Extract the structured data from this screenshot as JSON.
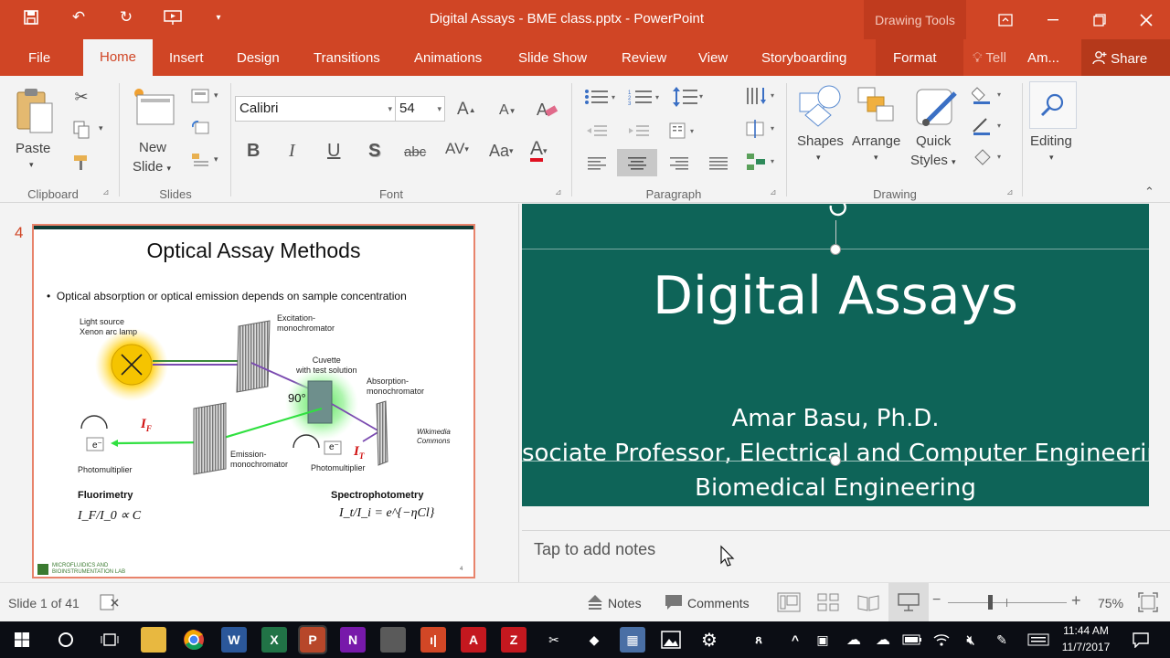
{
  "window": {
    "title": "Digital Assays - BME class.pptx - PowerPoint",
    "contextual_tab_group": "Drawing Tools"
  },
  "tabs": [
    "File",
    "Home",
    "Insert",
    "Design",
    "Transitions",
    "Animations",
    "Slide Show",
    "Review",
    "View",
    "Storyboarding",
    "Format"
  ],
  "tab_extra": {
    "tell": "Tell",
    "account": "Am...",
    "share": "Share"
  },
  "ribbon": {
    "clipboard": {
      "label": "Clipboard",
      "paste": "Paste"
    },
    "slides": {
      "label": "Slides",
      "new_slide_1": "New",
      "new_slide_2": "Slide"
    },
    "font": {
      "label": "Font",
      "font_name": "Calibri",
      "font_size": "54"
    },
    "paragraph": {
      "label": "Paragraph"
    },
    "drawing": {
      "label": "Drawing",
      "shapes": "Shapes",
      "arrange": "Arrange",
      "quick_styles_1": "Quick",
      "quick_styles_2": "Styles"
    },
    "editing": {
      "label": "Editing"
    }
  },
  "thumbnail": {
    "number": "4",
    "title": "Optical Assay Methods",
    "bullet": "Optical absorption or optical emission depends on sample concentration",
    "labels": {
      "light_source_1": "Light source",
      "light_source_2": "Xenon arc lamp",
      "excitation_1": "Excitation-",
      "excitation_2": "monochromator",
      "cuvette_1": "Cuvette",
      "cuvette_2": "with test solution",
      "angle": "90°",
      "absorption_1": "Absorption-",
      "absorption_2": "monochromator",
      "wikimedia_1": "Wikimedia",
      "wikimedia_2": "Commons",
      "emission_1": "Emission-",
      "emission_2": "monochromator",
      "pm_left": "Photomultiplier",
      "pm_right": "Photomultiplier",
      "electron": "e⁻",
      "i_f": "I",
      "i_f_sub": "F",
      "i_t": "I",
      "i_t_sub": "T",
      "fluorimetry": "Fluorimetry",
      "fluor_formula": "I_F/I_0 ∝ C",
      "spectro": "Spectrophotometry",
      "spectro_formula": "I_t/I_i = e^{−ηCl}",
      "lab_1": "Microfluidics and",
      "lab_2": "Bioinstrumentation Lab",
      "page": "4"
    }
  },
  "main_slide": {
    "title": "Digital Assays",
    "author": "Amar Basu, Ph.D.",
    "position": "Associate Professor, Electrical and Computer Engineering",
    "dept": "Biomedical Engineering"
  },
  "notes": {
    "placeholder": "Tap to add notes"
  },
  "statusbar": {
    "slide_info": "Slide 1 of 41",
    "notes": "Notes",
    "comments": "Comments",
    "zoom": "75%"
  },
  "taskbar": {
    "time": "11:44 AM",
    "date": "11/7/2017"
  },
  "colors": {
    "brand": "#d04525",
    "slide_bg": "#0e6458",
    "thumb_border": "#e8836b"
  }
}
